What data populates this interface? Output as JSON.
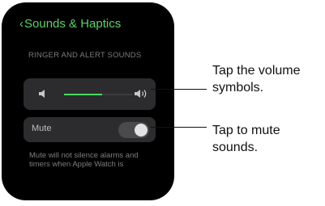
{
  "header": {
    "back_label": "Sounds & Haptics"
  },
  "ringer": {
    "section_label": "RINGER AND ALERT SOUNDS",
    "volume_level": 0.55
  },
  "mute": {
    "label": "Mute",
    "state": "off"
  },
  "footnote": "Mute will not silence alarms and timers when Apple Watch is",
  "callouts": {
    "volume": "Tap the volume symbols.",
    "mute": "Tap to mute sounds."
  },
  "colors": {
    "accent": "#5fd06a",
    "background": "#000000",
    "card": "#2c2c2e"
  }
}
